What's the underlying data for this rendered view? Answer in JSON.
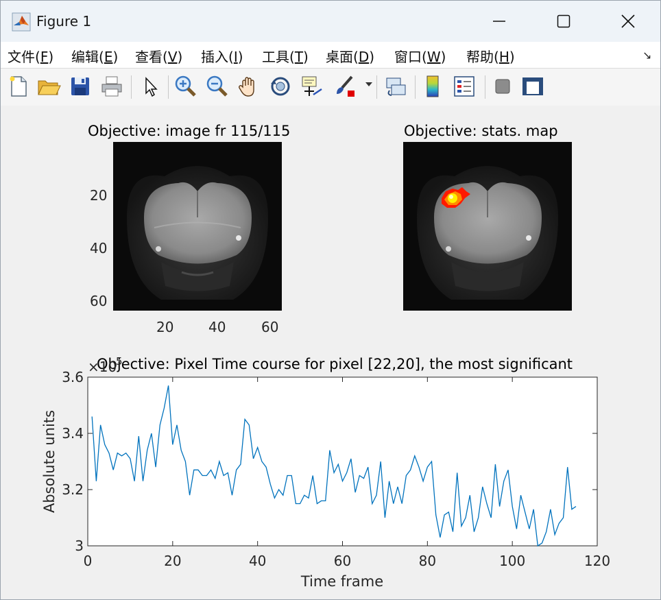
{
  "window": {
    "title": "Figure 1",
    "icon": "matlab-logo-icon"
  },
  "menu": {
    "items": [
      {
        "label": "文件(",
        "key": "F"
      },
      {
        "label": "编辑(",
        "key": "E"
      },
      {
        "label": "查看(",
        "key": "V"
      },
      {
        "label": "插入(",
        "key": "I"
      },
      {
        "label": "工具(",
        "key": "T"
      },
      {
        "label": "桌面(",
        "key": "D"
      },
      {
        "label": "窗口(",
        "key": "W"
      },
      {
        "label": "帮助(",
        "key": "H"
      }
    ],
    "dock_icon": "undock-arrow-icon"
  },
  "toolbar": {
    "buttons": [
      "new-figure-icon",
      "open-file-icon",
      "save-icon",
      "print-icon",
      "pointer-icon",
      "zoom-in-icon",
      "zoom-out-icon",
      "pan-hand-icon",
      "rotate-3d-icon",
      "data-cursor-icon",
      "brush-icon",
      "link-plot-icon",
      "colorbar-icon",
      "legend-icon",
      "hide-plot-tools-icon",
      "show-plot-tools-icon"
    ]
  },
  "image_axes": {
    "title": "Objective: image fr 115/115",
    "y_ticks": [
      "20",
      "40",
      "60"
    ],
    "x_ticks": [
      "20",
      "40",
      "60"
    ]
  },
  "stats_axes": {
    "title": "Objective: stats. map"
  },
  "colors": {
    "line": "#0072bd",
    "hotspot_outer": "#ff1a00",
    "hotspot_mid": "#ff8c00",
    "hotspot_inner": "#fff200"
  },
  "chart_data": {
    "type": "line",
    "title": "Objective: Pixel Time course for pixel [22,20], the most significant",
    "xlabel": "Time frame",
    "ylabel": "Absolute units",
    "exponent_label": "×10",
    "exponent_power": "5",
    "xlim": [
      0,
      120
    ],
    "ylim": [
      3.0,
      3.6
    ],
    "x_ticks": [
      0,
      20,
      40,
      60,
      80,
      100,
      120
    ],
    "y_ticks": [
      3,
      3.2,
      3.4,
      3.6
    ],
    "y_tick_labels": [
      "3",
      "3.2",
      "3.4",
      "3.6"
    ],
    "series": [
      {
        "x": [
          1,
          2,
          3,
          4,
          5,
          6,
          7,
          8,
          9,
          10,
          11,
          12,
          13,
          14,
          15,
          16,
          17,
          18,
          19,
          20,
          21,
          22,
          23,
          24,
          25,
          26,
          27,
          28,
          29,
          30,
          31,
          32,
          33,
          34,
          35,
          36,
          37,
          38,
          39,
          40,
          41,
          42,
          43,
          44,
          45,
          46,
          47,
          48,
          49,
          50,
          51,
          52,
          53,
          54,
          55,
          56,
          57,
          58,
          59,
          60,
          61,
          62,
          63,
          64,
          65,
          66,
          67,
          68,
          69,
          70,
          71,
          72,
          73,
          74,
          75,
          76,
          77,
          78,
          79,
          80,
          81,
          82,
          83,
          84,
          85,
          86,
          87,
          88,
          89,
          90,
          91,
          92,
          93,
          94,
          95,
          96,
          97,
          98,
          99,
          100,
          101,
          102,
          103,
          104,
          105,
          106,
          107,
          108,
          109,
          110,
          111,
          112,
          113,
          114,
          115
        ],
        "values": [
          3.46,
          3.23,
          3.43,
          3.36,
          3.33,
          3.27,
          3.33,
          3.32,
          3.33,
          3.31,
          3.23,
          3.39,
          3.23,
          3.34,
          3.4,
          3.28,
          3.43,
          3.49,
          3.57,
          3.36,
          3.43,
          3.34,
          3.3,
          3.18,
          3.27,
          3.27,
          3.25,
          3.25,
          3.27,
          3.24,
          3.3,
          3.25,
          3.26,
          3.18,
          3.27,
          3.29,
          3.45,
          3.43,
          3.31,
          3.35,
          3.3,
          3.28,
          3.22,
          3.17,
          3.2,
          3.18,
          3.25,
          3.25,
          3.15,
          3.15,
          3.18,
          3.17,
          3.25,
          3.15,
          3.16,
          3.16,
          3.34,
          3.26,
          3.29,
          3.23,
          3.26,
          3.31,
          3.19,
          3.25,
          3.24,
          3.28,
          3.15,
          3.18,
          3.3,
          3.1,
          3.23,
          3.15,
          3.21,
          3.15,
          3.25,
          3.27,
          3.32,
          3.28,
          3.23,
          3.28,
          3.3,
          3.11,
          3.03,
          3.11,
          3.12,
          3.05,
          3.26,
          3.07,
          3.1,
          3.18,
          3.05,
          3.1,
          3.21,
          3.15,
          3.1,
          3.29,
          3.14,
          3.23,
          3.27,
          3.14,
          3.06,
          3.18,
          3.12,
          3.06,
          3.13,
          3.0,
          3.01,
          3.05,
          3.13,
          3.04,
          3.08,
          3.1,
          3.28,
          3.13,
          3.14
        ]
      }
    ]
  }
}
